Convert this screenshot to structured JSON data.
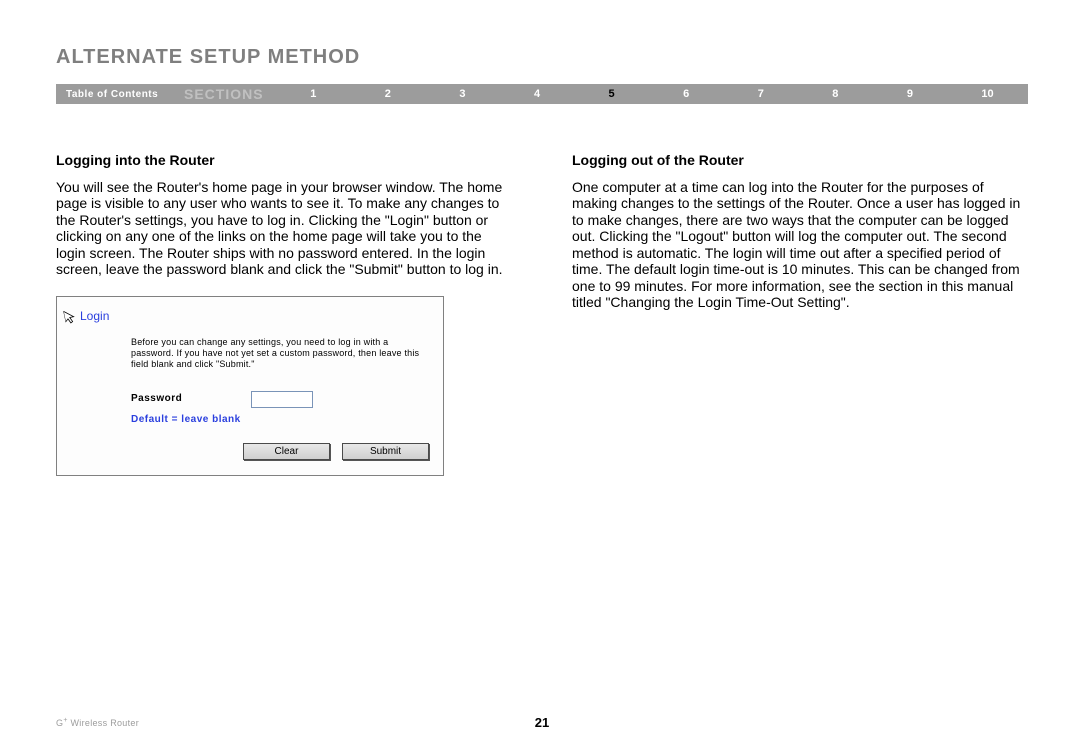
{
  "title": "ALTERNATE SETUP METHOD",
  "nav": {
    "toc": "Table of Contents",
    "sections_label": "SECTIONS",
    "numbers": [
      "1",
      "2",
      "3",
      "4",
      "5",
      "6",
      "7",
      "8",
      "9",
      "10"
    ],
    "active": "5"
  },
  "left": {
    "heading": "Logging into the Router",
    "body": "You will see the Router's home page in your browser window. The home page is visible to any user who wants to see it. To make any changes to the Router's settings, you have to log in. Clicking the \"Login\" button or clicking on any one of the links on the home page will take you to the login screen. The Router ships with no password entered. In the login screen, leave the password blank and click the \"Submit\" button to log in."
  },
  "right": {
    "heading": "Logging out of the Router",
    "body": "One computer at a time can log into the Router for the purposes of making changes to the settings of the Router. Once a user has logged in to make changes, there are two ways that the computer can be logged out. Clicking the \"Logout\" button will log the computer out. The second method is automatic. The login will time out after a specified period of time. The default login time-out is 10 minutes. This can be changed from one to 99 minutes. For more information, see the section in this manual titled \"Changing the Login Time-Out Setting\"."
  },
  "login_box": {
    "title": "Login",
    "instructions": "Before you can change any settings, you need to log in with a password. If you have not yet set a custom password, then leave this field blank and click \"Submit.\"",
    "password_label": "Password",
    "default_text": "Default = leave blank",
    "clear_btn": "Clear",
    "submit_btn": "Submit"
  },
  "footer": {
    "product_prefix": "G",
    "product_plus": "+",
    "product_suffix": " Wireless Router",
    "page": "21"
  }
}
